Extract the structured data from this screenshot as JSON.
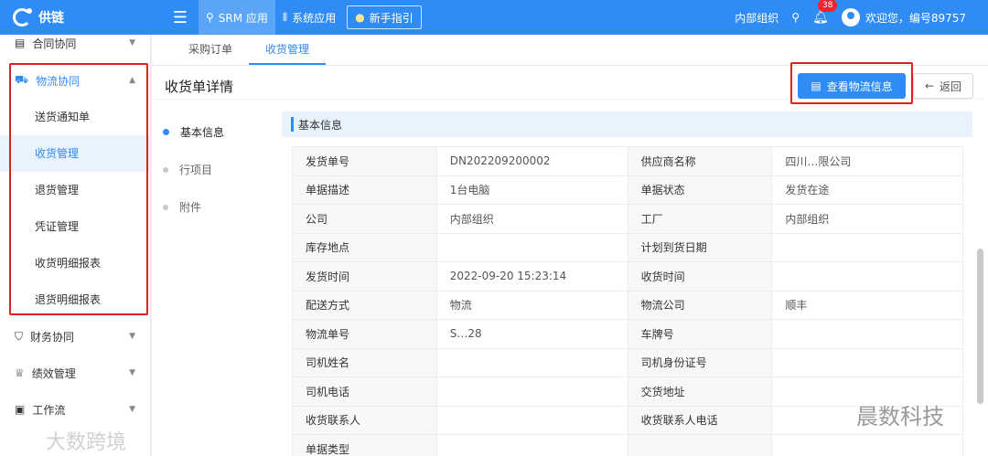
{
  "topbar": {
    "logo_text": "供链",
    "menu_icon": "menu-fold-icon",
    "nav": [
      {
        "label": "SRM 应用",
        "icon": "rocket-icon"
      },
      {
        "label": "系统应用",
        "icon": "apps-icon"
      },
      {
        "label": "新手指引",
        "icon": "bulb-icon"
      }
    ],
    "org": "内部组织",
    "notification_count": "38",
    "welcome": "欢迎您，编号89757"
  },
  "sidebar": {
    "groups": [
      {
        "label": "合同协同"
      },
      {
        "label": "物流协同",
        "items": [
          "送货通知单",
          "收货管理",
          "退货管理",
          "凭证管理",
          "收货明细报表",
          "退货明细报表"
        ]
      },
      {
        "label": "财务协同"
      },
      {
        "label": "绩效管理"
      },
      {
        "label": "工作流"
      }
    ],
    "active_item": "收货管理"
  },
  "tabs": [
    {
      "label": "采购订单"
    },
    {
      "label": "收货管理"
    }
  ],
  "page": {
    "title": "收货单详情",
    "view_logistics_label": "查看物流信息",
    "back_label": "返回",
    "steps": [
      "基本信息",
      "行项目",
      "附件"
    ],
    "section_title": "基本信息"
  },
  "details": [
    [
      "发货单号",
      "DN202209200002",
      "供应商名称",
      "四川…限公司"
    ],
    [
      "单据描述",
      "1台电脑",
      "单据状态",
      "发货在途"
    ],
    [
      "公司",
      "内部组织",
      "工厂",
      "内部组织"
    ],
    [
      "库存地点",
      "",
      "计划到货日期",
      ""
    ],
    [
      "发货时间",
      "2022-09-20 15:23:14",
      "收货时间",
      ""
    ],
    [
      "配送方式",
      "物流",
      "物流公司",
      "顺丰"
    ],
    [
      "物流单号",
      "S…28",
      "车牌号",
      ""
    ],
    [
      "司机姓名",
      "",
      "司机身份证号",
      ""
    ],
    [
      "司机电话",
      "",
      "交货地址",
      ""
    ],
    [
      "收货联系人",
      "",
      "收货联系人电话",
      ""
    ],
    [
      "单据类型",
      "",
      "",
      ""
    ]
  ],
  "watermarks": {
    "left": "大数跨境",
    "right": "晨数科技"
  },
  "colors": {
    "primary": "#2f8cf4",
    "highlight_box": "#e02020"
  }
}
